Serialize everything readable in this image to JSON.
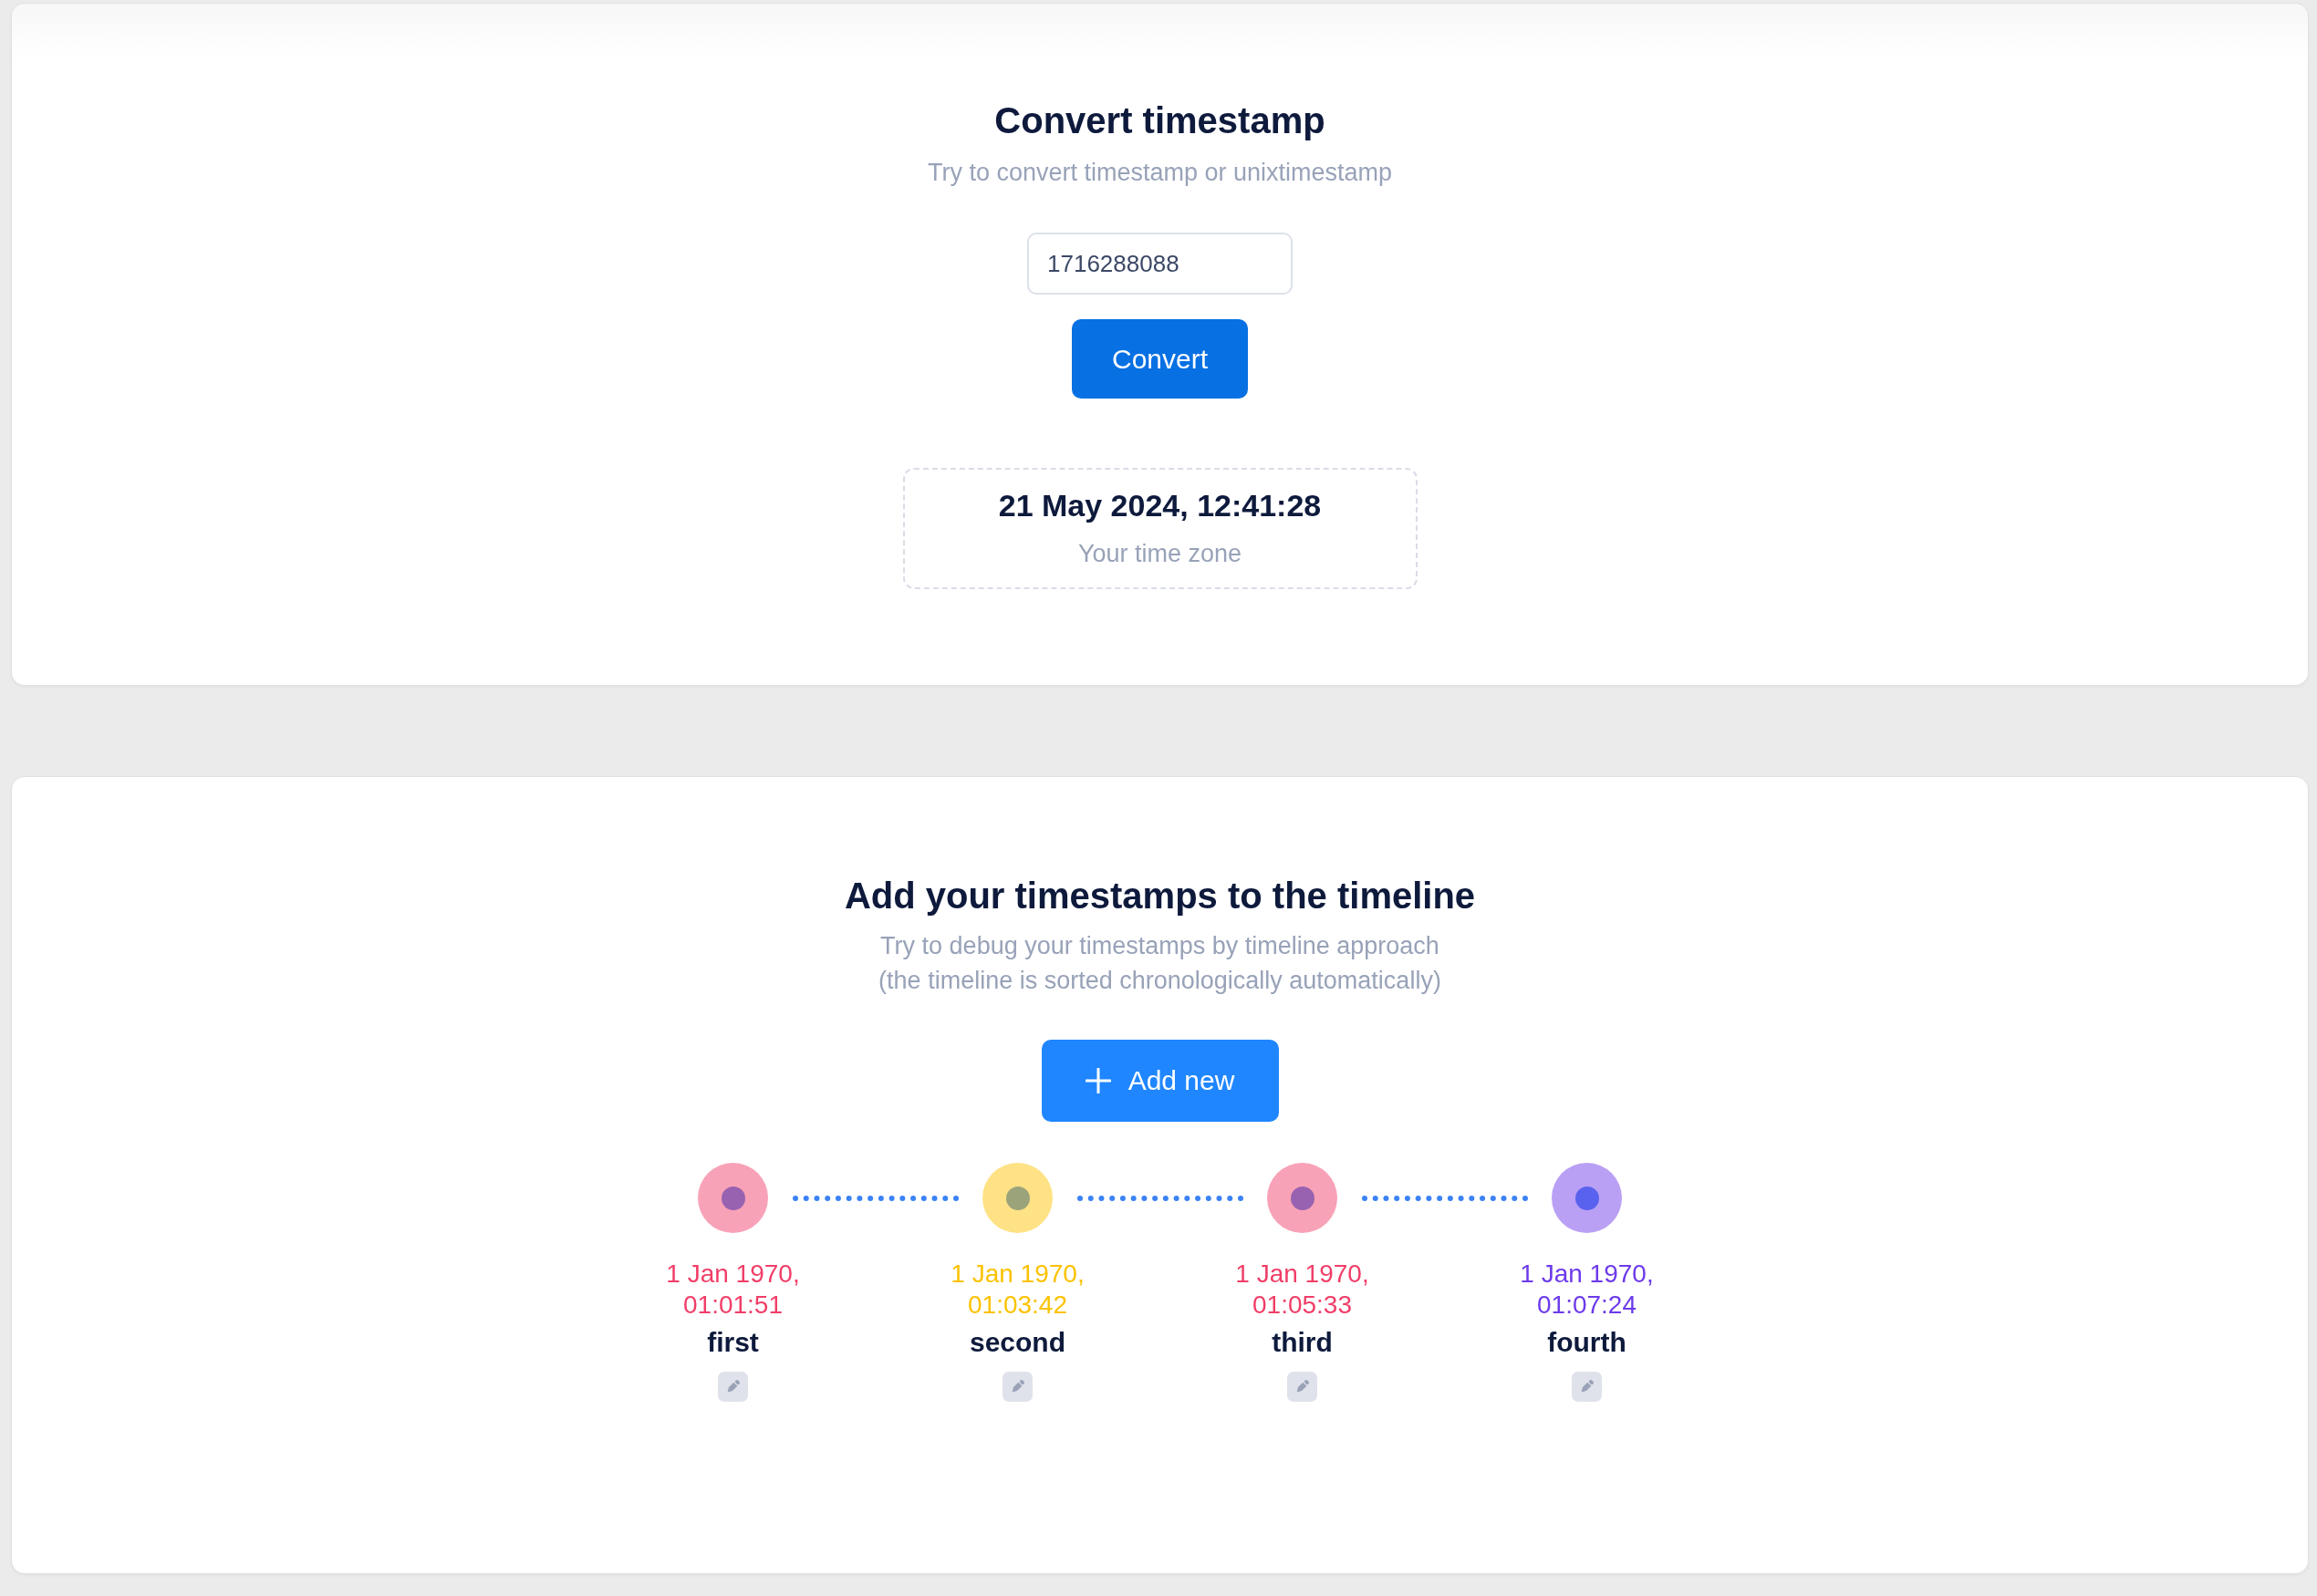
{
  "converter": {
    "title": "Convert timestamp",
    "subtitle": "Try to convert timestamp or unixtimestamp",
    "input": {
      "value": "1716288088"
    },
    "button": "Convert",
    "result": {
      "datetime": "21 May 2024, 12:41:28",
      "caption": "Your time zone"
    }
  },
  "timeline": {
    "title": "Add your timestamps to the timeline",
    "subtitle": "Try to debug your timestamps by timeline approach\n(the timeline is sorted chronologically automatically)",
    "add_button": "Add new",
    "items": [
      {
        "datetime": "1 Jan 1970, 01:01:51",
        "name": "first",
        "color": "#f03e68",
        "dot": {
          "color": "#9862b0"
        }
      },
      {
        "datetime": "1 Jan 1970, 01:03:42",
        "name": "second",
        "color": "#fcc200",
        "dot": {
          "color": "#9ba37b"
        }
      },
      {
        "datetime": "1 Jan 1970, 01:05:33",
        "name": "third",
        "color": "#f03e68",
        "dot": {
          "color": "#9862b0"
        }
      },
      {
        "datetime": "1 Jan 1970, 01:07:24",
        "name": "fourth",
        "color": "#6d3aea",
        "dot": {
          "color": "#5962ee"
        }
      }
    ]
  }
}
